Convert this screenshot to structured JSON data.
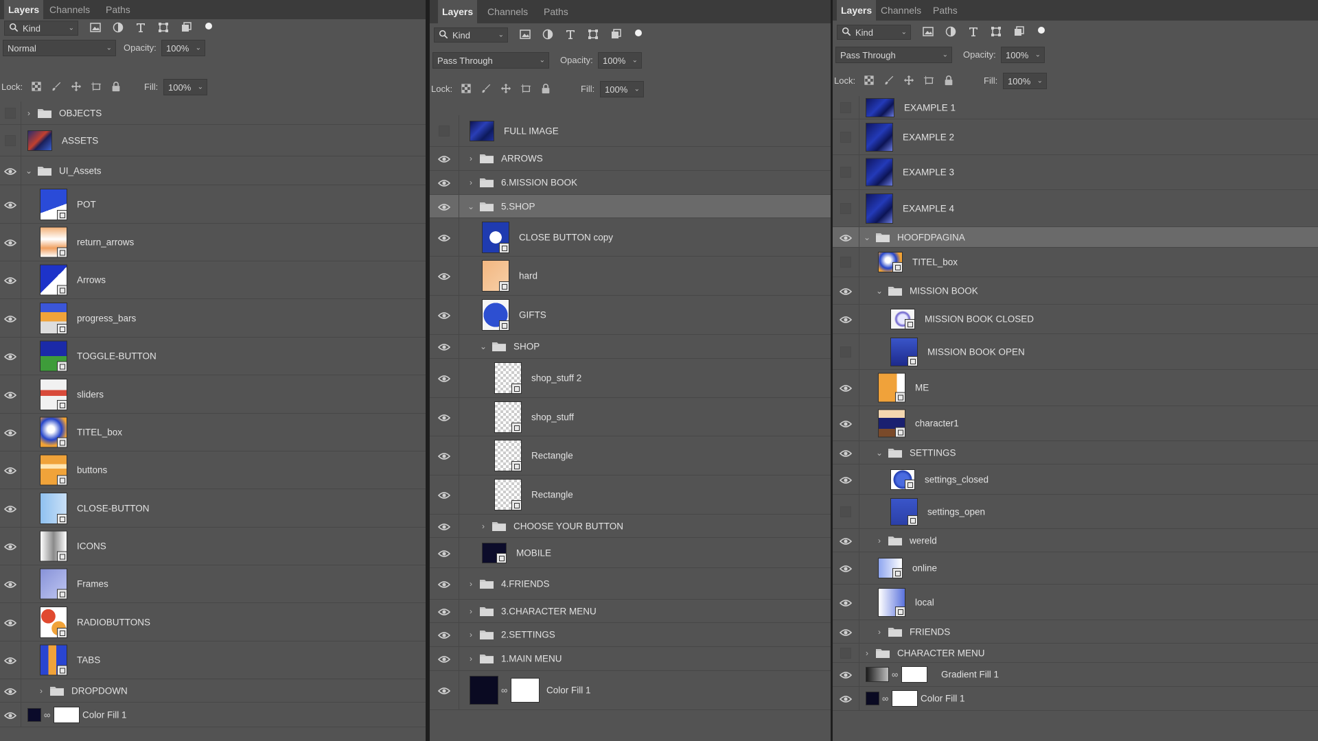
{
  "panels": [
    {
      "tabs": [
        "Layers",
        "Channels",
        "Paths"
      ],
      "filter": {
        "kind": "Kind"
      },
      "blend_mode": "Normal",
      "opacity_label": "Opacity:",
      "opacity": "100%",
      "lock_label": "Lock:",
      "fill_label": "Fill:",
      "fill": "100%",
      "layers": [
        {
          "name": "OBJECTS",
          "type": "folder",
          "collapsed": true,
          "visible": false,
          "indent": 0
        },
        {
          "name": "ASSETS",
          "type": "layer",
          "visible": false,
          "indent": 0,
          "thumb": "assets"
        },
        {
          "name": "UI_Assets",
          "type": "folder",
          "collapsed": false,
          "visible": true,
          "indent": 0
        },
        {
          "name": "POT",
          "type": "smart",
          "visible": true,
          "indent": 1,
          "thumb": "pot"
        },
        {
          "name": "return_arrows",
          "type": "smart",
          "visible": true,
          "indent": 1,
          "thumb": "arrows"
        },
        {
          "name": "Arrows",
          "type": "smart",
          "visible": true,
          "indent": 1,
          "thumb": "arrows2"
        },
        {
          "name": "progress_bars",
          "type": "smart",
          "visible": true,
          "indent": 1,
          "thumb": "bars"
        },
        {
          "name": "TOGGLE-BUTTON",
          "type": "smart",
          "visible": true,
          "indent": 1,
          "thumb": "toggle"
        },
        {
          "name": "sliders",
          "type": "smart",
          "visible": true,
          "indent": 1,
          "thumb": "sliders"
        },
        {
          "name": "TITEL_box",
          "type": "smart",
          "visible": true,
          "indent": 1,
          "thumb": "titel"
        },
        {
          "name": "buttons",
          "type": "smart",
          "visible": true,
          "indent": 1,
          "thumb": "buttons"
        },
        {
          "name": "CLOSE-BUTTON",
          "type": "smart",
          "visible": true,
          "indent": 1,
          "thumb": "close"
        },
        {
          "name": "ICONS",
          "type": "smart",
          "visible": true,
          "indent": 1,
          "thumb": "icons"
        },
        {
          "name": "Frames",
          "type": "smart",
          "visible": true,
          "indent": 1,
          "thumb": "frames"
        },
        {
          "name": "RADIOBUTTONS",
          "type": "smart",
          "visible": true,
          "indent": 1,
          "thumb": "radio"
        },
        {
          "name": "TABS",
          "type": "smart",
          "visible": true,
          "indent": 1,
          "thumb": "tabs"
        },
        {
          "name": "DROPDOWN",
          "type": "folder",
          "collapsed": true,
          "visible": true,
          "indent": 1
        },
        {
          "name": "Color Fill 1",
          "type": "fill",
          "visible": true,
          "indent": 0,
          "color": "#0b0b2a"
        }
      ]
    },
    {
      "tabs": [
        "Layers",
        "Channels",
        "Paths"
      ],
      "filter": {
        "kind": "Kind"
      },
      "blend_mode": "Pass Through",
      "opacity_label": "Opacity:",
      "opacity": "100%",
      "lock_label": "Lock:",
      "fill_label": "Fill:",
      "fill": "100%",
      "layers": [
        {
          "name": "FULL IMAGE",
          "type": "layer",
          "visible": false,
          "indent": 0,
          "thumb": "full"
        },
        {
          "name": "ARROWS",
          "type": "folder",
          "collapsed": true,
          "visible": true,
          "indent": 0
        },
        {
          "name": "6.MISSION BOOK",
          "type": "folder",
          "collapsed": true,
          "visible": true,
          "indent": 0
        },
        {
          "name": "5.SHOP",
          "type": "folder",
          "collapsed": false,
          "visible": true,
          "indent": 0,
          "selected": true
        },
        {
          "name": "CLOSE BUTTON copy",
          "type": "smart",
          "visible": true,
          "indent": 1,
          "thumb": "closecopy"
        },
        {
          "name": "hard",
          "type": "smart",
          "visible": true,
          "indent": 1,
          "thumb": "hard"
        },
        {
          "name": "GIFTS",
          "type": "smart",
          "visible": true,
          "indent": 1,
          "thumb": "gifts"
        },
        {
          "name": "SHOP",
          "type": "folder",
          "collapsed": false,
          "visible": true,
          "indent": 1
        },
        {
          "name": "shop_stuff 2",
          "type": "smart",
          "visible": true,
          "indent": 2,
          "thumb": "trans"
        },
        {
          "name": "shop_stuff",
          "type": "smart",
          "visible": true,
          "indent": 2,
          "thumb": "trans"
        },
        {
          "name": "Rectangle",
          "type": "shape",
          "visible": true,
          "indent": 2,
          "thumb": "trans"
        },
        {
          "name": "Rectangle",
          "type": "shape",
          "visible": true,
          "indent": 2,
          "thumb": "trans"
        },
        {
          "name": "CHOOSE YOUR BUTTON",
          "type": "folder",
          "collapsed": true,
          "visible": true,
          "indent": 1
        },
        {
          "name": "MOBILE",
          "type": "shape",
          "visible": true,
          "indent": 1,
          "thumb": "mobile"
        },
        {
          "name": "4.FRIENDS",
          "type": "folder",
          "collapsed": true,
          "visible": true,
          "indent": 0
        },
        {
          "name": "3.CHARACTER MENU",
          "type": "folder",
          "collapsed": true,
          "visible": true,
          "indent": 0
        },
        {
          "name": "2.SETTINGS",
          "type": "folder",
          "collapsed": true,
          "visible": true,
          "indent": 0
        },
        {
          "name": "1.MAIN MENU",
          "type": "folder",
          "collapsed": true,
          "visible": true,
          "indent": 0
        },
        {
          "name": "Color Fill 1",
          "type": "fill",
          "visible": true,
          "indent": 0,
          "color": "#0a0a22"
        }
      ]
    },
    {
      "tabs": [
        "Layers",
        "Channels",
        "Paths"
      ],
      "filter": {
        "kind": "Kind"
      },
      "blend_mode": "Pass Through",
      "opacity_label": "Opacity:",
      "opacity": "100%",
      "lock_label": "Lock:",
      "fill_label": "Fill:",
      "fill": "100%",
      "layers": [
        {
          "name": "EXAMPLE 1",
          "type": "layer",
          "visible": false,
          "indent": 0,
          "thumb": "ex"
        },
        {
          "name": "EXAMPLE 2",
          "type": "layer",
          "visible": false,
          "indent": 0,
          "thumb": "ex"
        },
        {
          "name": "EXAMPLE 3",
          "type": "layer",
          "visible": false,
          "indent": 0,
          "thumb": "ex"
        },
        {
          "name": "EXAMPLE 4",
          "type": "layer",
          "visible": false,
          "indent": 0,
          "thumb": "ex"
        },
        {
          "name": "HOOFDPAGINA",
          "type": "folder",
          "collapsed": false,
          "visible": true,
          "indent": 0,
          "selected": true
        },
        {
          "name": "TITEL_box",
          "type": "smart",
          "visible": false,
          "indent": 1,
          "thumb": "titel"
        },
        {
          "name": "MISSION BOOK",
          "type": "folder",
          "collapsed": false,
          "visible": true,
          "indent": 1
        },
        {
          "name": "MISSION BOOK CLOSED",
          "type": "smart",
          "visible": true,
          "indent": 2,
          "thumb": "mbclosed"
        },
        {
          "name": "MISSION BOOK OPEN",
          "type": "smart",
          "visible": false,
          "indent": 2,
          "thumb": "mbopen"
        },
        {
          "name": "ME",
          "type": "smart",
          "visible": true,
          "indent": 1,
          "thumb": "me"
        },
        {
          "name": "character1",
          "type": "smart",
          "visible": true,
          "indent": 1,
          "thumb": "char"
        },
        {
          "name": "SETTINGS",
          "type": "folder",
          "collapsed": false,
          "visible": true,
          "indent": 1
        },
        {
          "name": "settings_closed",
          "type": "smart",
          "visible": true,
          "indent": 2,
          "thumb": "setclosed"
        },
        {
          "name": "settings_open",
          "type": "smart",
          "visible": false,
          "indent": 2,
          "thumb": "setopen"
        },
        {
          "name": "wereld",
          "type": "folder",
          "collapsed": true,
          "visible": true,
          "indent": 1
        },
        {
          "name": "online",
          "type": "smart",
          "visible": true,
          "indent": 1,
          "thumb": "online"
        },
        {
          "name": "local",
          "type": "smart",
          "visible": true,
          "indent": 1,
          "thumb": "local"
        },
        {
          "name": "FRIENDS",
          "type": "folder",
          "collapsed": true,
          "visible": true,
          "indent": 1
        },
        {
          "name": "CHARACTER MENU",
          "type": "folder",
          "collapsed": true,
          "visible": false,
          "indent": 0
        },
        {
          "name": "Gradient Fill 1",
          "type": "gradient",
          "visible": true,
          "indent": 0
        },
        {
          "name": "Color Fill 1",
          "type": "fill",
          "visible": true,
          "indent": 0,
          "color": "#0a0a22"
        }
      ]
    }
  ],
  "icons": {
    "search": "search-icon",
    "filter_pixel": "image-filter-icon",
    "filter_adjust": "adjustment-filter-icon",
    "filter_type": "type-filter-icon",
    "filter_shape": "shape-filter-icon",
    "filter_smart": "smart-object-filter-icon",
    "filter_toggle": "filter-toggle-icon",
    "eye": "eye-icon",
    "folder": "folder-icon",
    "lock_transparent": "lock-transparent-icon",
    "lock_paint": "lock-paint-icon",
    "lock_move": "lock-position-icon",
    "lock_artboard": "lock-artboard-icon",
    "lock_all": "lock-all-icon"
  }
}
